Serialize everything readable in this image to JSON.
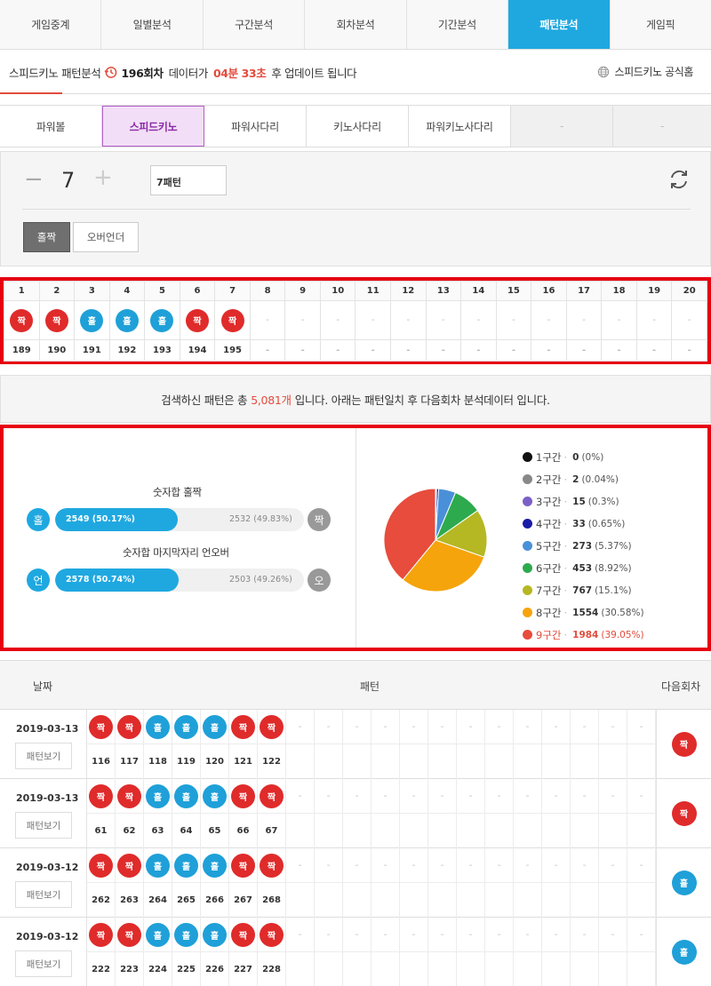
{
  "nav": {
    "tabs": [
      "게임중계",
      "일별분석",
      "구간분석",
      "회차분석",
      "기간분석",
      "패턴분석",
      "게임픽"
    ],
    "active_index": 5
  },
  "info": {
    "title": "스피드키노 패턴분석",
    "round": "196회차",
    "text1": "데이터가",
    "time": "04분 33초",
    "text2": "후 업데이트 됩니다",
    "home_link": "스피드키노 공식홈"
  },
  "game_tabs": {
    "items": [
      "파워볼",
      "스피드키노",
      "파워사다리",
      "키노사다리",
      "파워키노사다리",
      "-",
      "-"
    ],
    "active_index": 1
  },
  "control": {
    "minus": "−",
    "count": "7",
    "plus": "+",
    "pattern_input": "7패턴",
    "btn_oddeven": "홀짝",
    "btn_overunder": "오버언더"
  },
  "pattern_grid": {
    "headers": [
      "1",
      "2",
      "3",
      "4",
      "5",
      "6",
      "7",
      "8",
      "9",
      "10",
      "11",
      "12",
      "13",
      "14",
      "15",
      "16",
      "17",
      "18",
      "19",
      "20"
    ],
    "balls": [
      "짝",
      "짝",
      "홀",
      "홀",
      "홀",
      "짝",
      "짝",
      "-",
      "-",
      "-",
      "-",
      "-",
      "-",
      "-",
      "-",
      "-",
      "-",
      "-",
      "-",
      "-"
    ],
    "ball_colors": [
      "red",
      "red",
      "blue",
      "blue",
      "blue",
      "red",
      "red",
      "",
      "",
      "",
      "",
      "",
      "",
      "",
      "",
      "",
      "",
      "",
      "",
      ""
    ],
    "rounds": [
      "189",
      "190",
      "191",
      "192",
      "193",
      "194",
      "195",
      "-",
      "-",
      "-",
      "-",
      "-",
      "-",
      "-",
      "-",
      "-",
      "-",
      "-",
      "-",
      "-"
    ]
  },
  "summary": {
    "pre": "검색하신 패턴은 총",
    "count": "5,081개",
    "post": "입니다. 아래는 패턴일치 후 다음회차 분석데이터 입니다."
  },
  "stats": {
    "bar1": {
      "title": "숫자합 홀짝",
      "left_icon": "홀",
      "right_icon": "짝",
      "left_label": "2549 (50.17%)",
      "right_label": "2532 (49.83%)",
      "fraction": 0.5017
    },
    "bar2": {
      "title": "숫자합 마지막자리 언오버",
      "left_icon": "언",
      "right_icon": "오",
      "left_label": "2578 (50.74%)",
      "right_label": "2503 (49.26%)",
      "fraction": 0.5074
    },
    "colors": {
      "accent": "#1fa8e0",
      "grey": "#999999"
    }
  },
  "chart_data": {
    "type": "pie",
    "series": [
      {
        "name": "1구간",
        "value": 0,
        "pct": "(0%)",
        "color": "#111111"
      },
      {
        "name": "2구간",
        "value": 2,
        "pct": "(0.04%)",
        "color": "#888888"
      },
      {
        "name": "3구간",
        "value": 15,
        "pct": "(0.3%)",
        "color": "#7b5fc7"
      },
      {
        "name": "4구간",
        "value": 33,
        "pct": "(0.65%)",
        "color": "#1a1aa8"
      },
      {
        "name": "5구간",
        "value": 273,
        "pct": "(5.37%)",
        "color": "#4a90d9"
      },
      {
        "name": "6구간",
        "value": 453,
        "pct": "(8.92%)",
        "color": "#2eaa4e"
      },
      {
        "name": "7구간",
        "value": 767,
        "pct": "(15.1%)",
        "color": "#b5b823"
      },
      {
        "name": "8구간",
        "value": 1554,
        "pct": "(30.58%)",
        "color": "#f6a40c"
      },
      {
        "name": "9구간",
        "value": 1984,
        "pct": "(39.05%)",
        "color": "#e74c3c"
      }
    ],
    "highlight_index": 8
  },
  "history": {
    "headers": {
      "date": "날짜",
      "pattern": "패턴",
      "next": "다음회차"
    },
    "view_label": "패턴보기",
    "rows": [
      {
        "date": "2019-03-13",
        "balls": [
          "짝",
          "짝",
          "홀",
          "홀",
          "홀",
          "짝",
          "짝"
        ],
        "colors": [
          "red",
          "red",
          "blue",
          "blue",
          "blue",
          "red",
          "red"
        ],
        "rounds": [
          "116",
          "117",
          "118",
          "119",
          "120",
          "121",
          "122"
        ],
        "next": "짝",
        "next_color": "red"
      },
      {
        "date": "2019-03-13",
        "balls": [
          "짝",
          "짝",
          "홀",
          "홀",
          "홀",
          "짝",
          "짝"
        ],
        "colors": [
          "red",
          "red",
          "blue",
          "blue",
          "blue",
          "red",
          "red"
        ],
        "rounds": [
          "61",
          "62",
          "63",
          "64",
          "65",
          "66",
          "67"
        ],
        "next": "짝",
        "next_color": "red"
      },
      {
        "date": "2019-03-12",
        "balls": [
          "짝",
          "짝",
          "홀",
          "홀",
          "홀",
          "짝",
          "짝"
        ],
        "colors": [
          "red",
          "red",
          "blue",
          "blue",
          "blue",
          "red",
          "red"
        ],
        "rounds": [
          "262",
          "263",
          "264",
          "265",
          "266",
          "267",
          "268"
        ],
        "next": "홀",
        "next_color": "blue"
      },
      {
        "date": "2019-03-12",
        "balls": [
          "짝",
          "짝",
          "홀",
          "홀",
          "홀",
          "짝",
          "짝"
        ],
        "colors": [
          "red",
          "red",
          "blue",
          "blue",
          "blue",
          "red",
          "red"
        ],
        "rounds": [
          "222",
          "223",
          "224",
          "225",
          "226",
          "227",
          "228"
        ],
        "next": "홀",
        "next_color": "blue"
      }
    ],
    "empty_cell": "-"
  }
}
